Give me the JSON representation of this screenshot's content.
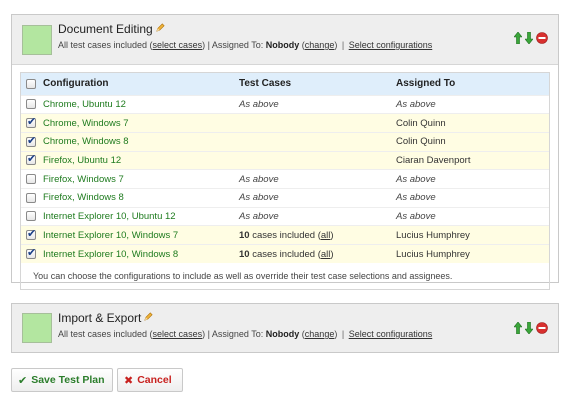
{
  "groups": [
    {
      "title": "Document Editing",
      "color": "#b3e6a0",
      "summary_prefix": "All test cases included (",
      "select_cases": "select cases",
      "assigned_prefix": ") | Assigned To: ",
      "assignee": "Nobody",
      "change": "change",
      "select_configurations": "Select configurations",
      "table": {
        "headers": [
          "Configuration",
          "Test Cases",
          "Assigned To"
        ],
        "rows": [
          {
            "checked": false,
            "config": "Chrome, Ubuntu 12",
            "tests": "As above",
            "assigned": "As above"
          },
          {
            "checked": true,
            "config": "Chrome, Windows 7",
            "tests": "",
            "assigned": "Colin Quinn"
          },
          {
            "checked": true,
            "config": "Chrome, Windows 8",
            "tests": "",
            "assigned": "Colin Quinn"
          },
          {
            "checked": true,
            "config": "Firefox, Ubuntu 12",
            "tests": "",
            "assigned": "Ciaran Davenport"
          },
          {
            "checked": false,
            "config": "Firefox, Windows 7",
            "tests": "As above",
            "assigned": "As above"
          },
          {
            "checked": false,
            "config": "Firefox, Windows 8",
            "tests": "As above",
            "assigned": "As above"
          },
          {
            "checked": false,
            "config": "Internet Explorer 10, Ubuntu 12",
            "tests": "As above",
            "assigned": "As above"
          },
          {
            "checked": true,
            "config": "Internet Explorer 10, Windows 7",
            "tests_count": "10",
            "tests_text": " cases included (",
            "tests_link": "all",
            "tests_close": ")",
            "assigned": "Lucius Humphrey"
          },
          {
            "checked": true,
            "config": "Internet Explorer 10, Windows 8",
            "tests_count": "10",
            "tests_text": " cases included (",
            "tests_link": "all",
            "tests_close": ")",
            "assigned": "Lucius Humphrey"
          }
        ]
      },
      "note": "You can choose the configurations to include as well as override their test case selections and assignees."
    },
    {
      "title": "Import & Export",
      "color": "#b3e6a0",
      "summary_prefix": "All test cases included (",
      "select_cases": "select cases",
      "assigned_prefix": ") | Assigned To: ",
      "assignee": "Nobody",
      "change": "change",
      "select_configurations": "Select configurations"
    }
  ],
  "buttons": {
    "save": "Save Test Plan",
    "cancel": "Cancel"
  },
  "icons": {
    "move_up": "arrow-up-icon",
    "move_down": "arrow-down-icon",
    "remove": "remove-icon",
    "edit": "pencil-icon",
    "save": "checkmark-icon",
    "cancel": "cross-icon"
  }
}
